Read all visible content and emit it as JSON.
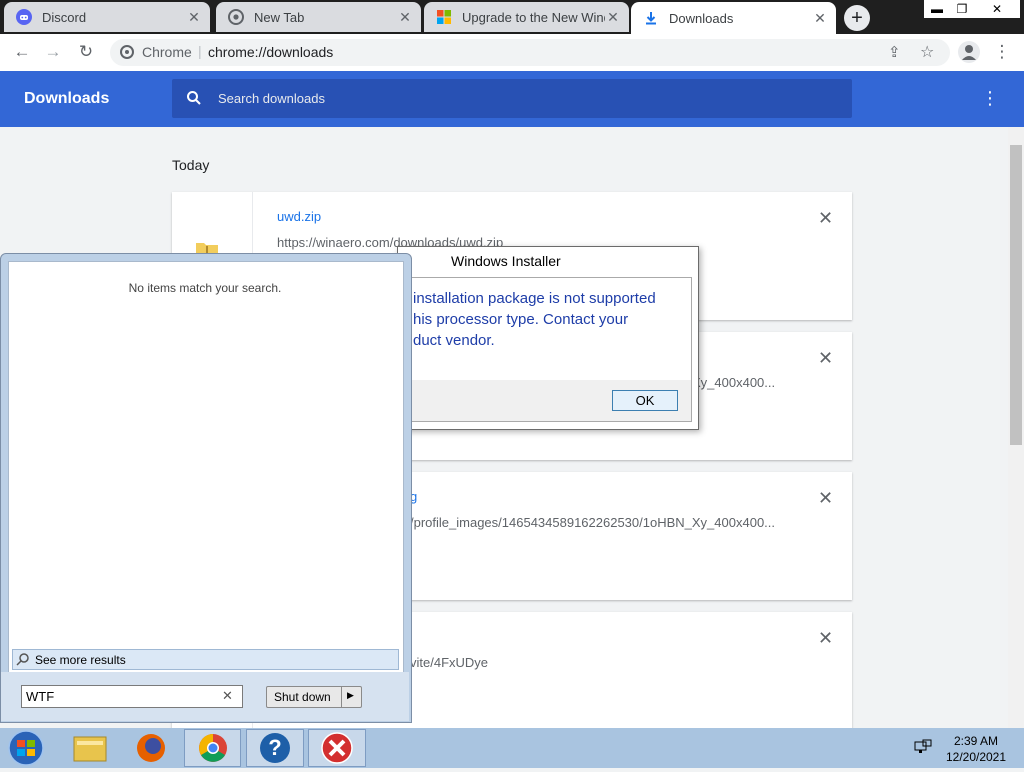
{
  "browser": {
    "tabs": [
      {
        "title": "Discord",
        "icon": "discord-icon"
      },
      {
        "title": "New Tab",
        "icon": "chrome-icon"
      },
      {
        "title": "Upgrade to the New Wind",
        "icon": "microsoft-icon"
      },
      {
        "title": "Downloads",
        "icon": "download-icon",
        "active": true
      }
    ],
    "omnibox_site": "Chrome",
    "omnibox_url": "chrome://downloads"
  },
  "downloads": {
    "title": "Downloads",
    "search_placeholder": "Search downloads",
    "section": "Today",
    "items": [
      {
        "name": "uwd.zip",
        "url": "https://winaero.com/downloads/uwd.zip"
      },
      {
        "name": "",
        "url": "Xy_400x400..."
      },
      {
        "name": "g",
        "url": "/profile_images/1465434589162262530/1oHBN_Xy_400x400..."
      },
      {
        "name": "",
        "url": "vite/4FxUDye"
      }
    ]
  },
  "installer": {
    "title": "Windows Installer",
    "message_lines": [
      "installation package is not supported",
      "his processor type. Contact your",
      "duct vendor."
    ],
    "ok_label": "OK"
  },
  "startmenu": {
    "no_items": "No items match your search.",
    "see_more": "See more results",
    "search_value": "WTF",
    "shutdown_label": "Shut down"
  },
  "taskbar": {
    "time": "2:39 AM",
    "date": "12/20/2021"
  }
}
